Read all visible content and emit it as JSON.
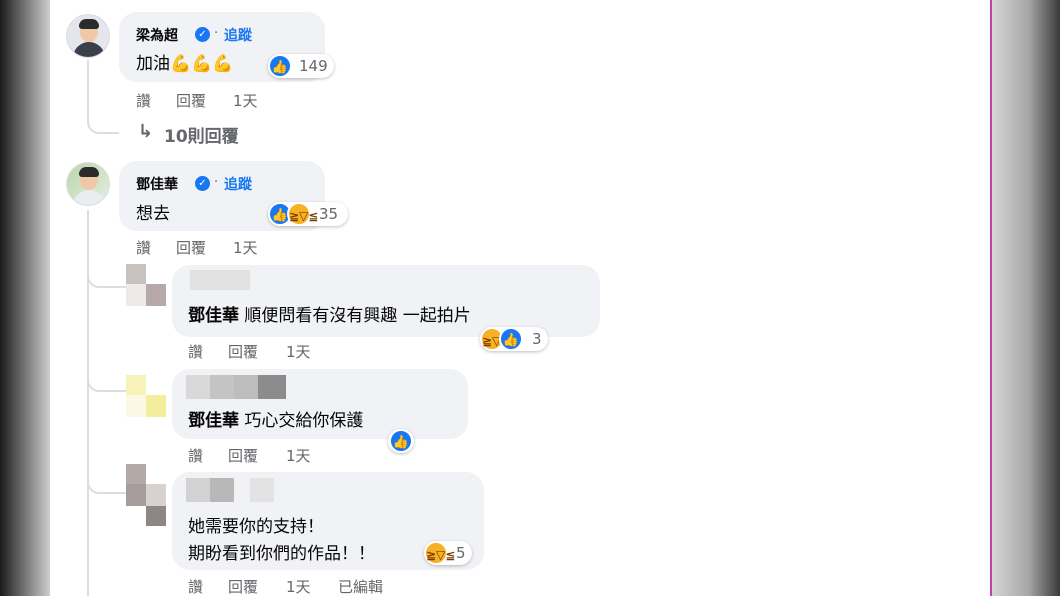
{
  "comments": [
    {
      "author": "梁為超",
      "follow": "追蹤",
      "text": "加油💪💪💪",
      "reactions": 149,
      "actions": {
        "like": "讚",
        "reply": "回覆",
        "time": "1天"
      },
      "replies_link": "10則回覆"
    },
    {
      "author": "鄧佳華",
      "follow": "追蹤",
      "text": "想去",
      "reactions": 35,
      "actions": {
        "like": "讚",
        "reply": "回覆",
        "time": "1天"
      }
    }
  ],
  "replies": [
    {
      "mention": "鄧佳華",
      "text": "順便問看有沒有興趣 一起拍片",
      "reactions": "3",
      "actions": {
        "like": "讚",
        "reply": "回覆",
        "time": "1天"
      }
    },
    {
      "mention": "鄧佳華",
      "text": "巧心交給你保護",
      "actions": {
        "like": "讚",
        "reply": "回覆",
        "time": "1天"
      }
    },
    {
      "line1": "她需要你的支持！",
      "line2": "期盼看到你們的作品！！",
      "reactions": "5",
      "actions": {
        "like": "讚",
        "reply": "回覆",
        "time": "1天",
        "edited": "已編輯"
      }
    }
  ],
  "colors": {
    "accent": "#1877f2",
    "bubble": "#f0f2f5",
    "muted": "#65676b"
  }
}
